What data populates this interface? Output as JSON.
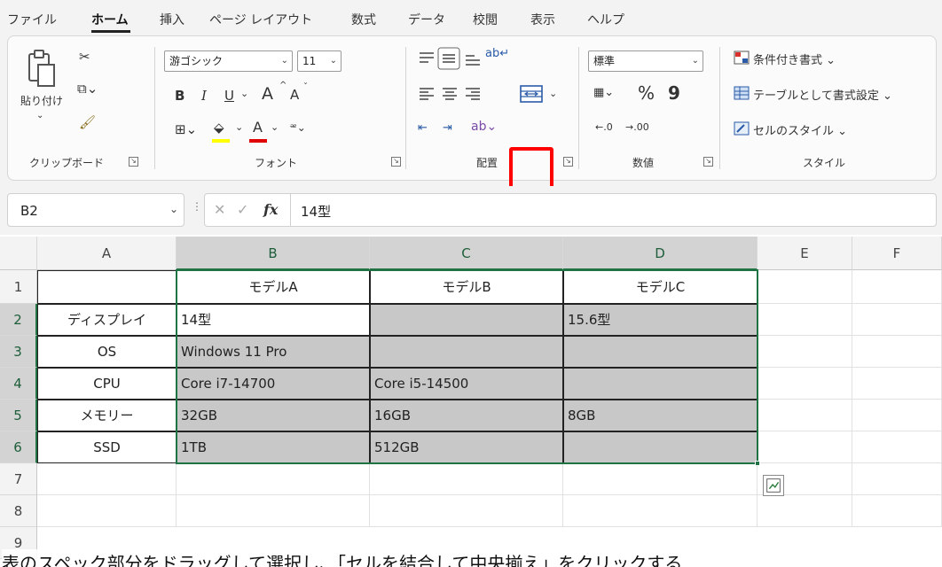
{
  "menu": {
    "tabs": [
      "ファイル",
      "ホーム",
      "挿入",
      "ページ レイアウト",
      "数式",
      "データ",
      "校閲",
      "表示",
      "ヘルプ"
    ],
    "active_tab": "ホーム"
  },
  "ribbon": {
    "clipboard": {
      "paste_label": "貼り付け",
      "group_label": "クリップボード"
    },
    "font": {
      "font_name": "游ゴシック",
      "font_size": "11",
      "bold": "B",
      "italic": "I",
      "underline": "U",
      "grow": "A",
      "shrink": "A",
      "font_color": "A",
      "group_label": "フォント"
    },
    "alignment": {
      "group_label": "配置",
      "merge_center_label": "セルを結合して中央揃え"
    },
    "number": {
      "format": "標準",
      "percent": "%",
      "comma": "9",
      "group_label": "数値"
    },
    "styles": {
      "conditional": "条件付き書式",
      "as_table": "テーブルとして書式設定",
      "cell_styles": "セルのスタイル",
      "group_label": "スタイル"
    }
  },
  "formula_bar": {
    "name_box": "B2",
    "fx": "fx",
    "formula": "14型"
  },
  "sheet": {
    "columns": [
      "A",
      "B",
      "C",
      "D",
      "E",
      "F"
    ],
    "rows": [
      "1",
      "2",
      "3",
      "4",
      "5",
      "6",
      "7",
      "8",
      "9"
    ],
    "header_row": [
      "",
      "モデルA",
      "モデルB",
      "モデルC"
    ],
    "data": [
      [
        "ディスプレイ",
        "14型",
        "",
        "15.6型"
      ],
      [
        "OS",
        "Windows 11 Pro",
        "",
        ""
      ],
      [
        "CPU",
        "Core i7-14700",
        "Core i5-14500",
        ""
      ],
      [
        "メモリー",
        "32GB",
        "16GB",
        "8GB"
      ],
      [
        "SSD",
        "1TB",
        "512GB",
        ""
      ]
    ]
  },
  "caption": "表のスペック部分をドラッグして選択し、「セルを結合して中央揃え」をクリックする"
}
